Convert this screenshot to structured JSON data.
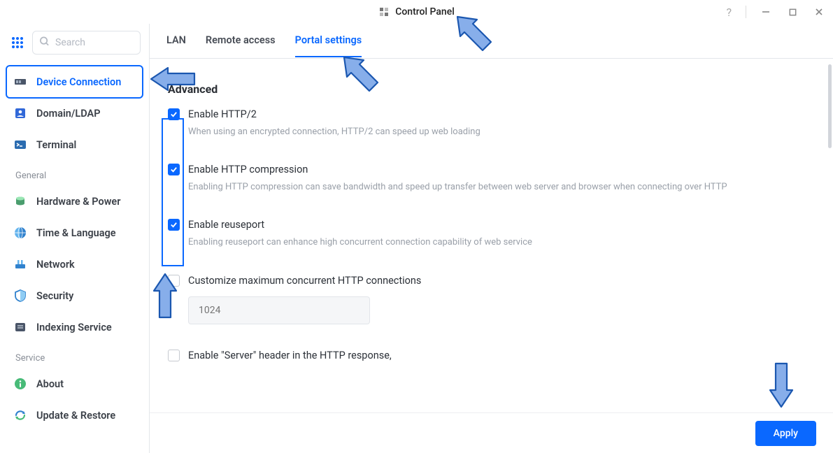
{
  "window": {
    "title": "Control Panel"
  },
  "search": {
    "placeholder": "Search"
  },
  "sidebar": {
    "items": [
      {
        "label": "Device Connection"
      },
      {
        "label": "Domain/LDAP"
      },
      {
        "label": "Terminal"
      }
    ],
    "section_general": "General",
    "general_items": [
      {
        "label": "Hardware & Power"
      },
      {
        "label": "Time & Language"
      },
      {
        "label": "Network"
      },
      {
        "label": "Security"
      },
      {
        "label": "Indexing Service"
      }
    ],
    "section_service": "Service",
    "service_items": [
      {
        "label": "About"
      },
      {
        "label": "Update & Restore"
      }
    ]
  },
  "tabs": {
    "lan": "LAN",
    "remote": "Remote access",
    "portal": "Portal settings"
  },
  "advanced": {
    "title": "Advanced",
    "http2_label": "Enable HTTP/2",
    "http2_desc": "When using an encrypted connection, HTTP/2 can speed up web loading",
    "compress_label": "Enable HTTP compression",
    "compress_desc": "Enabling HTTP compression can save bandwidth and speed up transfer between web server and browser when connecting over HTTP",
    "reuseport_label": "Enable reuseport",
    "reuseport_desc": "Enabling reuseport can enhance high concurrent connection capability of web service",
    "maxconn_label": "Customize maximum concurrent HTTP connections",
    "maxconn_placeholder": "1024",
    "server_header_label": "Enable \"Server\" header in the HTTP response,"
  },
  "footer": {
    "apply": "Apply"
  },
  "colors": {
    "accent": "#0a68ff",
    "arrow_fill": "#89aee8",
    "arrow_stroke": "#1b4fa0"
  }
}
